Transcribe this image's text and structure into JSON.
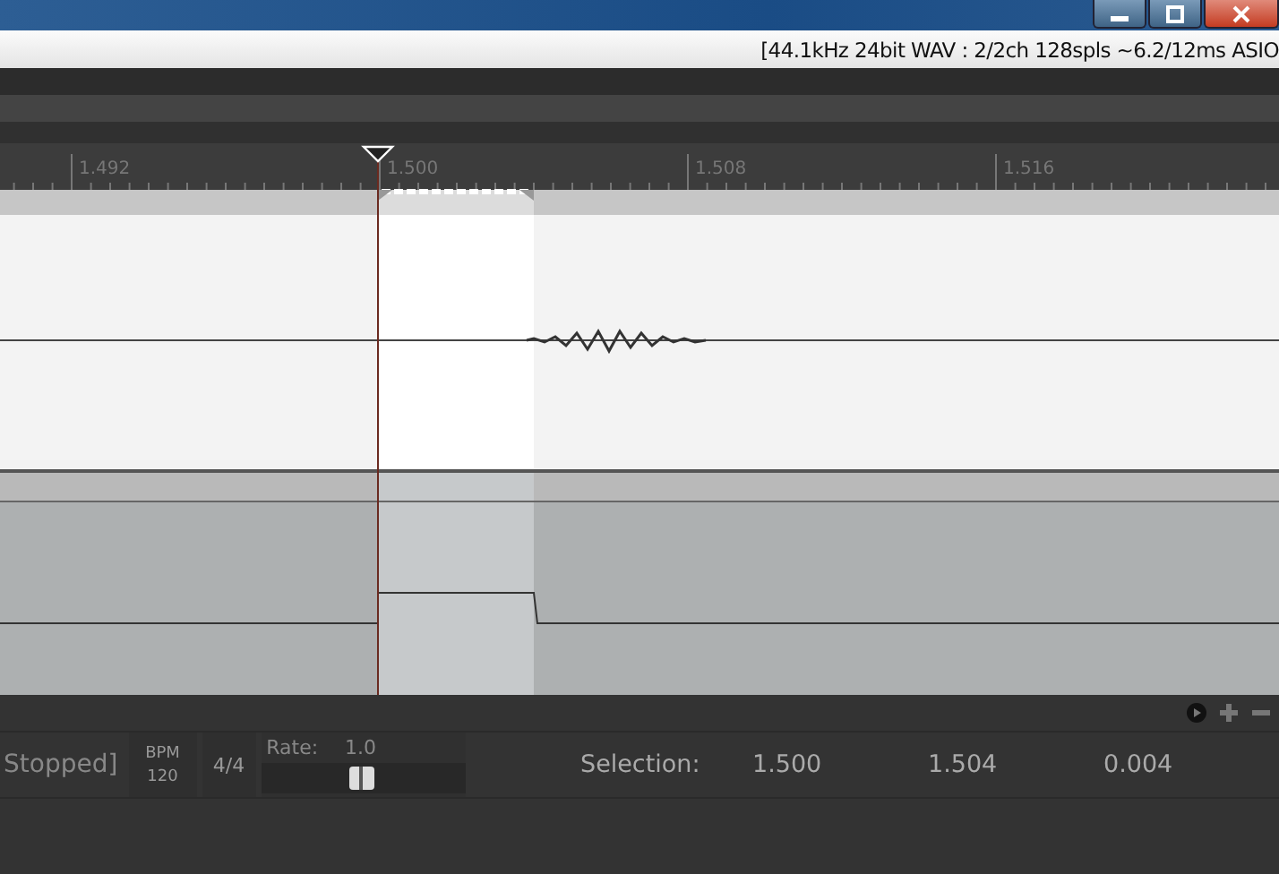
{
  "status_bar": {
    "text": "[44.1kHz 24bit WAV : 2/2ch 128spls ~6.2/12ms ASIO"
  },
  "ruler": {
    "labels": [
      "1.492",
      "1.500",
      "1.508",
      "1.516"
    ]
  },
  "transport": {
    "state": "Stopped]",
    "bpm_label": "BPM",
    "bpm": "120",
    "time_signature": "4/4",
    "rate": {
      "label": "Rate:",
      "value": "1.0",
      "level": 0.5
    },
    "selection_label": "Selection:",
    "selection_start": "1.500",
    "selection_end": "1.504",
    "selection_length": "0.004"
  }
}
